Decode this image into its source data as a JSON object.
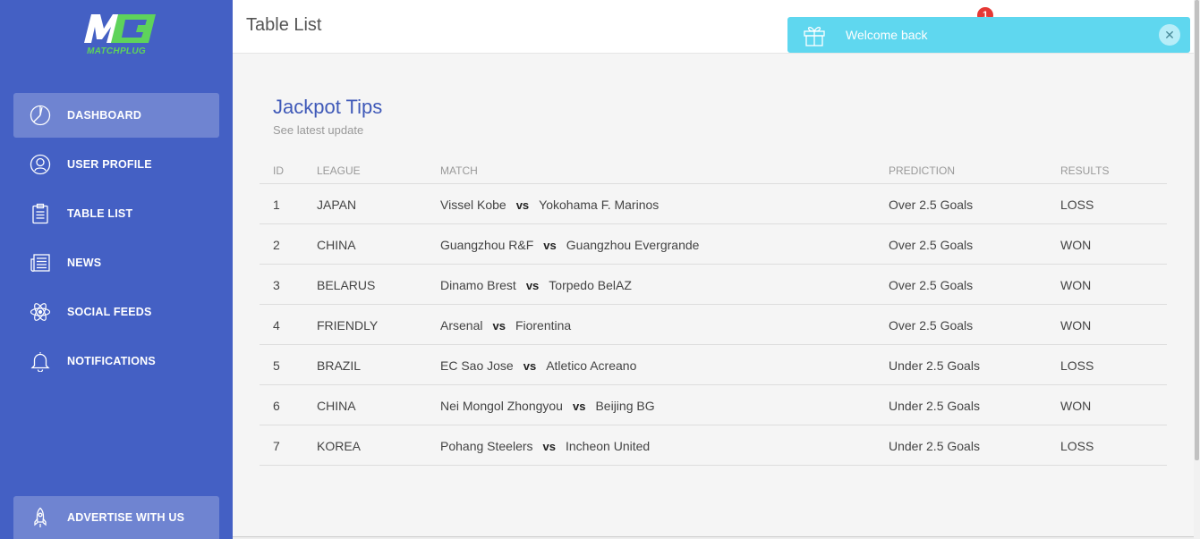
{
  "brand": {
    "logo_text": "MATCHPLUG",
    "logo_mark": "M",
    "green": "#5ed35b",
    "sidebar_color": "#4460c4"
  },
  "sidebar": {
    "items": [
      {
        "label": "DASHBOARD",
        "icon": "pie-chart-icon"
      },
      {
        "label": "USER PROFILE",
        "icon": "user-icon"
      },
      {
        "label": "TABLE LIST",
        "icon": "clipboard-icon"
      },
      {
        "label": "NEWS",
        "icon": "newspaper-icon"
      },
      {
        "label": "SOCIAL FEEDS",
        "icon": "atom-icon"
      },
      {
        "label": "NOTIFICATIONS",
        "icon": "bell-icon"
      }
    ],
    "advertise_label": "ADVERTISE WITH US",
    "advertise_icon": "rocket-icon"
  },
  "header": {
    "title": "Table List",
    "notification_count": "1"
  },
  "toast": {
    "message": "Welcome back",
    "close": "✕",
    "icon": "gift-icon",
    "color": "#5fd7ef"
  },
  "card": {
    "title": "Jackpot Tips",
    "subtitle": "See latest update"
  },
  "table": {
    "headers": [
      "ID",
      "LEAGUE",
      "MATCH",
      "PREDICTION",
      "RESULTS"
    ],
    "vs_label": "vs",
    "rows": [
      {
        "id": "1",
        "league": "JAPAN",
        "home": "Vissel Kobe",
        "away": "Yokohama F. Marinos",
        "prediction": "Over 2.5 Goals",
        "result": "LOSS"
      },
      {
        "id": "2",
        "league": "CHINA",
        "home": "Guangzhou R&F",
        "away": "Guangzhou Evergrande",
        "prediction": "Over 2.5 Goals",
        "result": "WON"
      },
      {
        "id": "3",
        "league": "BELARUS",
        "home": "Dinamo Brest",
        "away": "Torpedo BelAZ",
        "prediction": "Over 2.5 Goals",
        "result": "WON"
      },
      {
        "id": "4",
        "league": "FRIENDLY",
        "home": "Arsenal",
        "away": "Fiorentina",
        "prediction": "Over 2.5 Goals",
        "result": "WON"
      },
      {
        "id": "5",
        "league": "BRAZIL",
        "home": "EC Sao Jose",
        "away": "Atletico Acreano",
        "prediction": "Under 2.5 Goals",
        "result": "LOSS"
      },
      {
        "id": "6",
        "league": "CHINA",
        "home": "Nei Mongol Zhongyou",
        "away": "Beijing BG",
        "prediction": "Under 2.5 Goals",
        "result": "WON"
      },
      {
        "id": "7",
        "league": "KOREA",
        "home": "Pohang Steelers",
        "away": "Incheon United",
        "prediction": "Under 2.5 Goals",
        "result": "LOSS"
      }
    ]
  }
}
